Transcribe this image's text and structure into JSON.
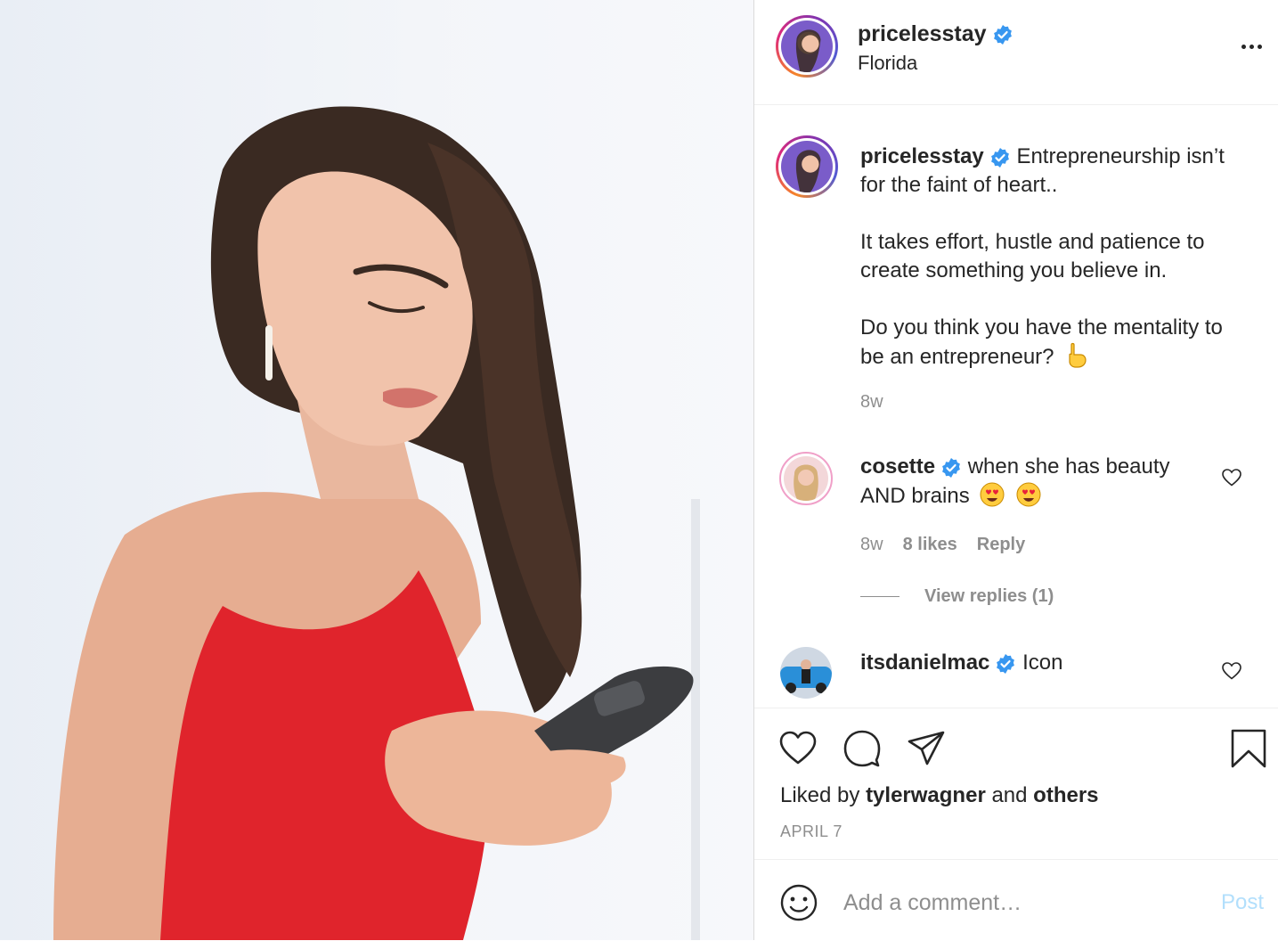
{
  "post": {
    "username": "pricelesstay",
    "location": "Florida",
    "verified": true,
    "photo_alt": "Woman in red one-shoulder dress looking at smartphone"
  },
  "header": {
    "more_icon": "more-options-icon"
  },
  "caption": {
    "username": "pricelesstay",
    "line1": "Entrepreneurship isn’t for the faint of heart..",
    "line2": "It takes effort, hustle and patience to create something you believe in.",
    "line3": "Do you think you have the mentality to be an entrepreneur?",
    "emoji": "backhand-index-pointing-down",
    "time": "8w"
  },
  "comments": [
    {
      "username": "cosette",
      "text": "when she has beauty AND brains",
      "emoji": "heart-eyes x2",
      "time": "8w",
      "likes": "8 likes",
      "reply_label": "Reply",
      "view_replies": "View replies (1)"
    },
    {
      "username": "itsdanielmac",
      "text": "Icon"
    }
  ],
  "actions": {
    "liked_prefix": "Liked by",
    "liked_user": "tylerwagner",
    "liked_and": "and",
    "liked_others": "others",
    "date": "APRIL 7"
  },
  "composer": {
    "placeholder": "Add a comment…",
    "post_label": "Post"
  },
  "colors": {
    "verified": "#3897f0",
    "muted": "#8e8e8e",
    "post_disabled": "#b2dffc",
    "dress": "#e0242c"
  }
}
